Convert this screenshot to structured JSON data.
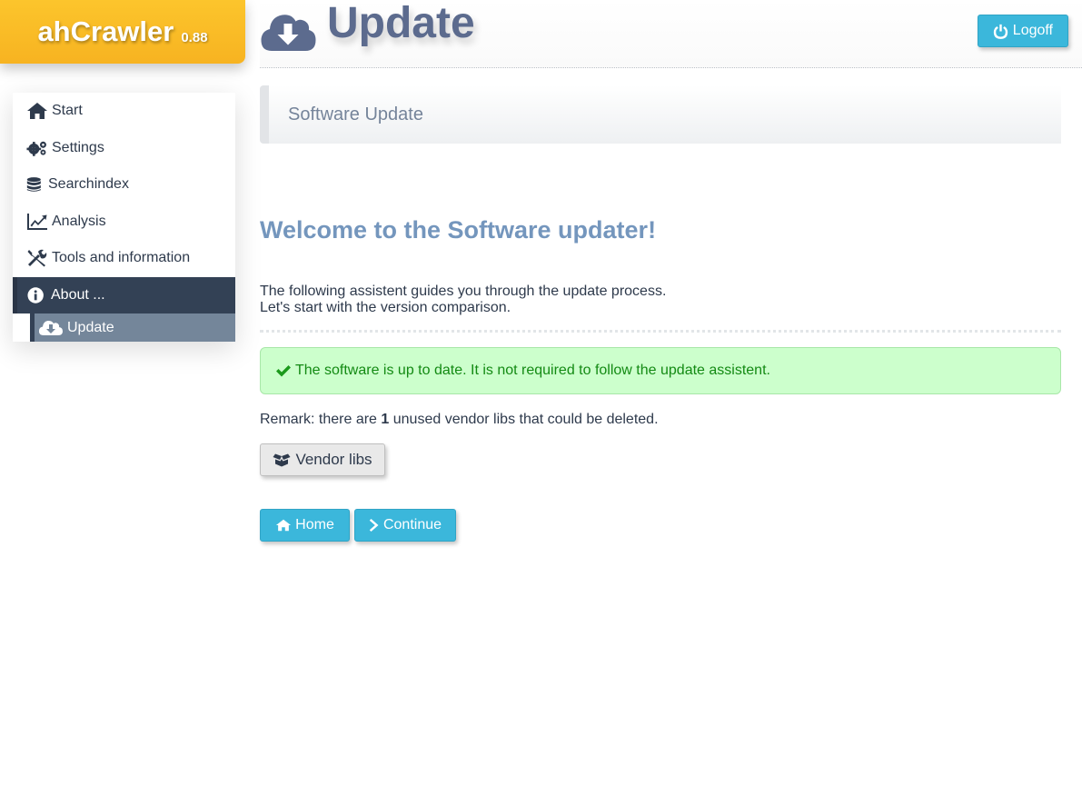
{
  "app": {
    "name": "ahCrawler",
    "version": "0.88"
  },
  "header": {
    "title": "Update",
    "logoff_label": "Logoff"
  },
  "sidebar": {
    "items": [
      {
        "label": "Start",
        "icon": "home-icon"
      },
      {
        "label": "Settings",
        "icon": "gears-icon"
      },
      {
        "label": "Searchindex",
        "icon": "database-icon"
      },
      {
        "label": "Analysis",
        "icon": "chart-line-icon"
      },
      {
        "label": "Tools and information",
        "icon": "tools-icon"
      },
      {
        "label": "About ...",
        "icon": "info-circle-icon",
        "active": true
      }
    ],
    "subitems": [
      {
        "label": "Update",
        "icon": "cloud-download-icon",
        "active": true
      }
    ]
  },
  "section": {
    "title": "Software Update"
  },
  "main": {
    "welcome": "Welcome to the Software updater!",
    "intro_line1": "The following assistent guides you through the update process.",
    "intro_line2": "Let's start with the version comparison.",
    "alert": "The software is up to date. It is not required to follow the update assistent.",
    "remark_prefix": "Remark: there are",
    "remark_count": "1",
    "remark_suffix": "unused vendor libs that could be deleted.",
    "vendor_button": "Vendor libs",
    "home_button": "Home",
    "continue_button": "Continue"
  },
  "colors": {
    "brand": "#f7b321",
    "accent": "#3bb7db",
    "nav_active": "#334155",
    "success_bg": "#ccffcc",
    "title": "#5c6b8e"
  }
}
